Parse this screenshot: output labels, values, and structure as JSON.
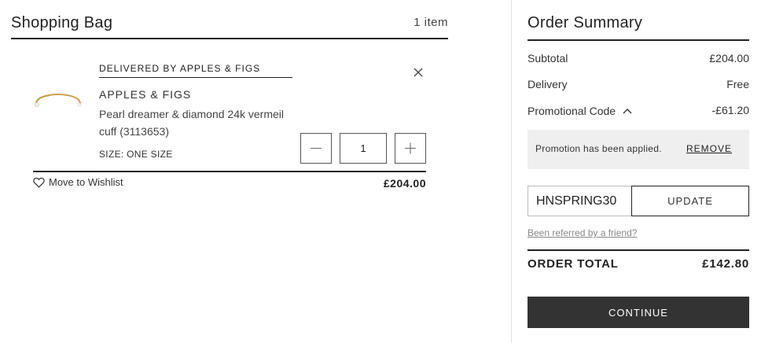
{
  "bag": {
    "title": "Shopping Bag",
    "item_count": "1 item"
  },
  "item": {
    "delivered_by": "DELIVERED BY APPLES & FIGS",
    "brand": "APPLES & FIGS",
    "name": "Pearl dreamer & diamond 24k vermeil cuff (3113653)",
    "size": "SIZE: ONE SIZE",
    "quantity": "1",
    "price": "£204.00",
    "wishlist_label": "Move to Wishlist",
    "image": "gold-pearl-cuff-bracelet"
  },
  "summary": {
    "title": "Order Summary",
    "subtotal_label": "Subtotal",
    "subtotal_value": "£204.00",
    "delivery_label": "Delivery",
    "delivery_value": "Free",
    "promo_label": "Promotional Code",
    "promo_value": "-£61.20",
    "promo_message": "Promotion has been applied.",
    "promo_remove": "REMOVE",
    "promo_code": "HNSPRING30",
    "update_label": "UPDATE",
    "referred_link": "Been referred by a friend?",
    "total_label": "ORDER TOTAL",
    "total_value": "£142.80",
    "continue_label": "CONTINUE"
  },
  "colors": {
    "text": "#222222",
    "promo_bg": "#efefef",
    "button_dark": "#333333",
    "link_muted": "#888888"
  }
}
